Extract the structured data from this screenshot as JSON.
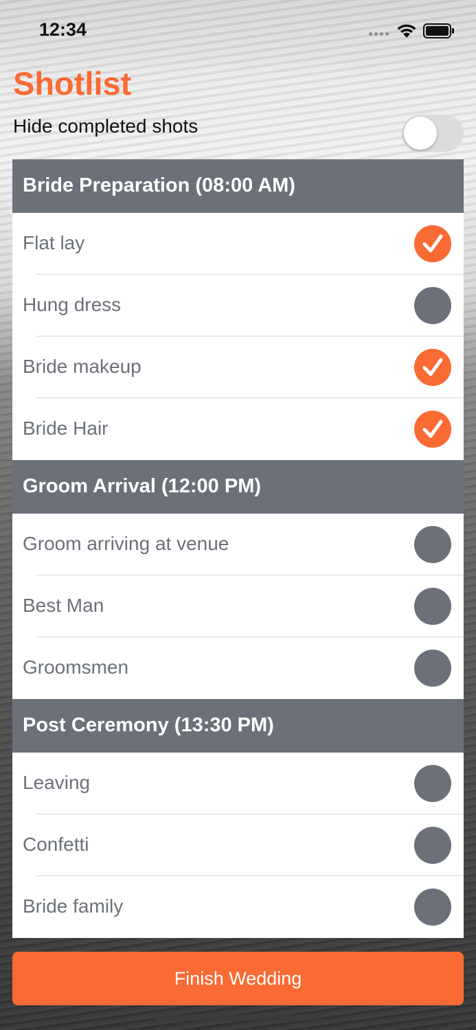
{
  "status_bar": {
    "time": "12:34"
  },
  "header": {
    "title": "Shotlist",
    "hide_completed_label": "Hide completed shots",
    "hide_completed_on": false
  },
  "sections": [
    {
      "title": "Bride Preparation (08:00 AM)",
      "shots": [
        {
          "label": "Flat lay",
          "done": true
        },
        {
          "label": "Hung dress",
          "done": false
        },
        {
          "label": "Bride makeup",
          "done": true
        },
        {
          "label": "Bride Hair",
          "done": true
        }
      ]
    },
    {
      "title": "Groom Arrival (12:00 PM)",
      "shots": [
        {
          "label": "Groom arriving at venue",
          "done": false
        },
        {
          "label": "Best Man",
          "done": false
        },
        {
          "label": "Groomsmen",
          "done": false
        }
      ]
    },
    {
      "title": "Post Ceremony (13:30 PM)",
      "shots": [
        {
          "label": "Leaving",
          "done": false
        },
        {
          "label": "Confetti",
          "done": false
        },
        {
          "label": "Bride family",
          "done": false
        }
      ]
    }
  ],
  "footer": {
    "finish_label": "Finish Wedding"
  },
  "colors": {
    "accent": "#fa6a33",
    "section_header": "#6b7079",
    "pending_check": "#6b7079"
  },
  "icons": {
    "done": "checkmark-icon",
    "pending": "circle-icon"
  }
}
